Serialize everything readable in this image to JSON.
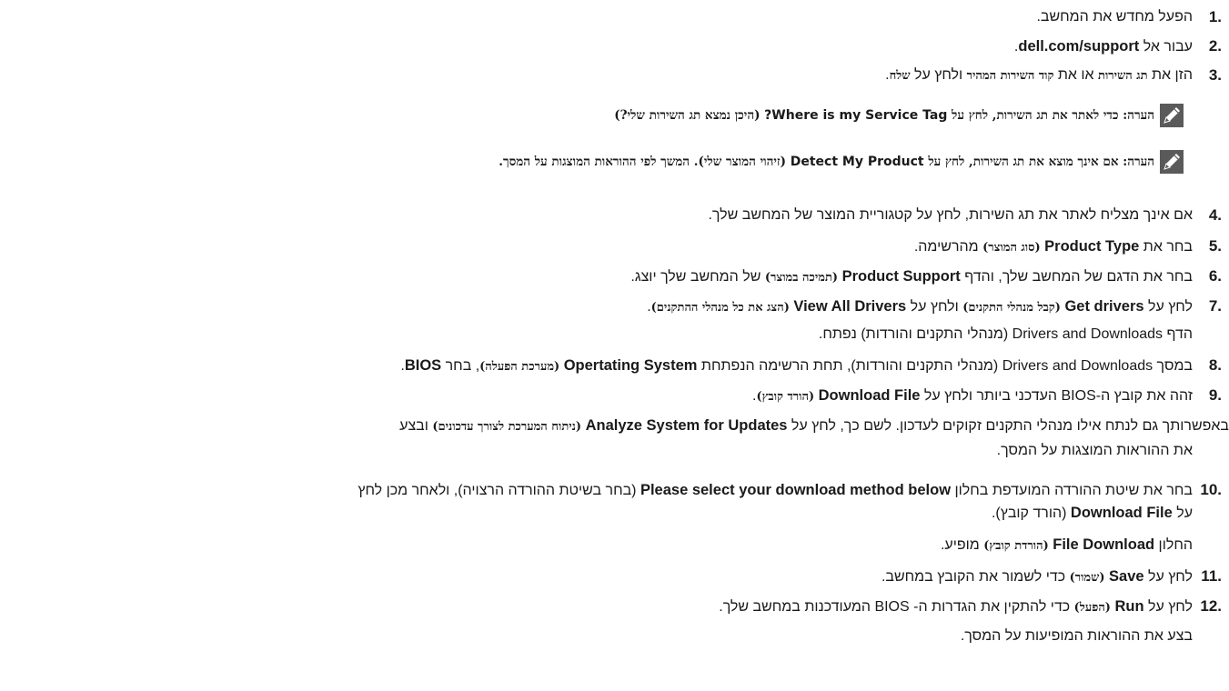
{
  "steps": [
    {
      "n": "1.",
      "t1": "הפעל מחדש את המחשב."
    },
    {
      "n": "2.",
      "t1": "עבור אל ",
      "b1": "dell.com/support",
      "t2": "."
    },
    {
      "n": "3.",
      "t1": "הזן את ",
      "b1": "תג השירות",
      "t2": " או את ",
      "b2": "קוד השירות המהיר",
      "t3": " ולחץ על ",
      "b3": "שלח",
      "t4": "."
    },
    {
      "n": "4.",
      "t1": "אם אינך מצליח לאתר את תג השירות, לחץ על קטגוריית המוצר של המחשב שלך."
    },
    {
      "n": "5.",
      "t1": "בחר את ",
      "b1": "Product Type",
      "s1": " (סוג המוצר)",
      "t2": " מהרשימה."
    },
    {
      "n": "6.",
      "t1": "בחר את הדגם של המחשב שלך, והדף ",
      "b1": "Product Support",
      "s1": " (תמיכה במוצר)",
      "t2": " של המחשב שלך יוצג."
    },
    {
      "n": "7.",
      "t1": "לחץ על ",
      "b1": "Get drivers",
      "s1": " (קבל מנהלי התקנים)",
      "t2": " ולחץ על ",
      "b2": "View All Drivers",
      "s2": " (הצג את כל מנהלי ההתקנים)",
      "t3": "."
    },
    {
      "n": "8.",
      "t1": "במסך ",
      "e1": "Drivers and Downloads",
      "t2": " (מנהלי התקנים והורדות), תחת הרשימה הנפתחת ",
      "b1": "Opertating System",
      "s1": " (מערכת הפעלה)",
      "t3": ", בחר ",
      "b2": "BIOS",
      "t4": "."
    },
    {
      "n": "9.",
      "t1": "זהה את קובץ ה-BIOS העדכני ביותר ולחץ על ",
      "b1": "Download File",
      "s1": " (הורד קובץ)",
      "t2": "."
    },
    {
      "n": "10.",
      "t1": "בחר את שיטת ההורדה המועדפת בחלון ",
      "b1": "Please select your download method below",
      "t2": " (בחר בשיטת ההורדה הרצויה), ולאחר מכן לחץ",
      "t3": "על ",
      "b2": "Download File",
      "t4": " (הורד קובץ)."
    },
    {
      "n": "11.",
      "t1": "לחץ על ",
      "b1": "Save",
      "s1": " (שמור)",
      "t2": " כדי לשמור את הקובץ במחשב."
    },
    {
      "n": "12.",
      "t1": "לחץ על ",
      "b1": "Run",
      "s1": " (הפעל)",
      "t2": " כדי להתקין את הגדרות ה- BIOS המעודכנות במחשב שלך."
    }
  ],
  "notes": [
    {
      "t1": "הערה: כדי לאתר את תג השירות, לחץ על ",
      "e1": "Where is my Service Tag?",
      "t2": " (היכן נמצא תג השירות שלי?)"
    },
    {
      "t1": "הערה: אם אינך מוצא את תג השירות, לחץ על ",
      "e1": "Detect My Product",
      "t2": " (זיהוי המוצר שלי). המשך לפי ההוראות המוצגות על המסך."
    }
  ],
  "sub": {
    "s7": {
      "t1": "הדף ",
      "e1": "Drivers and Downloads",
      "t2": " (מנהלי התקנים והורדות) נפתח."
    },
    "s9a": {
      "t1": "באפשרותך גם לנתח אילו מנהלי התקנים זקוקים לעדכון. לשם כך, לחץ על ",
      "b1": "Analyze System for Updates",
      "s1": " (ניתוח המערכת לצורך עדכונים)",
      "t2": " ובצע"
    },
    "s9b": {
      "t1": "את ההוראות המוצגות על המסך."
    },
    "s10": {
      "t1": "החלון ",
      "b1": "File Download",
      "s1": " (הורדת קובץ)",
      "t2": " מופיע."
    },
    "s12": {
      "t1": "בצע את ההוראות המופיעות על המסך."
    }
  },
  "colors": {
    "text": "#1a1a1a",
    "icon_bg": "#5a5a5a",
    "icon_fg": "#ffffff"
  },
  "icons": {
    "note": "pencil-note-icon"
  }
}
